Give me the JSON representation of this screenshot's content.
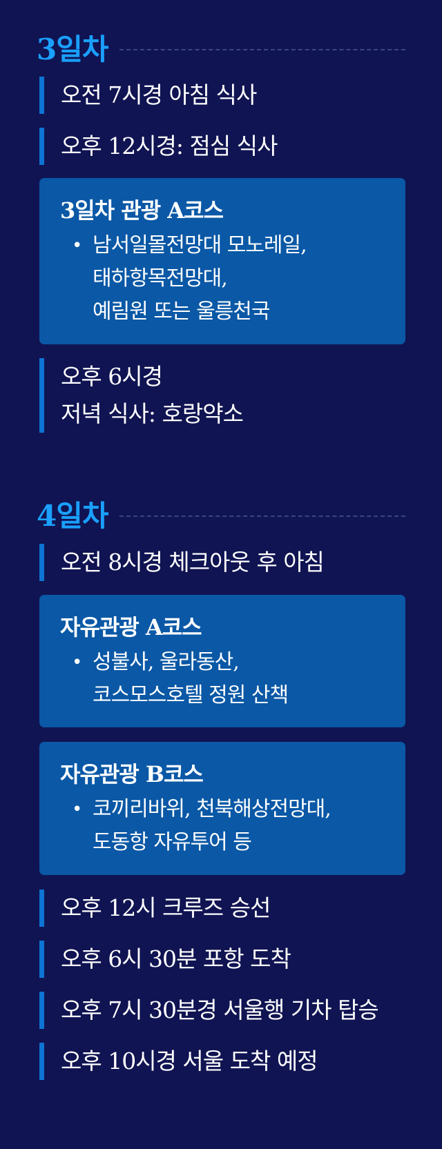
{
  "day3": {
    "title": "3일차",
    "items": [
      "오전 7시경 아침 식사",
      "오후 12시경: 점심 식사"
    ],
    "card": {
      "title": "3일차 관광 A코스",
      "lines": [
        "남서일몰전망대 모노레일,",
        "태하항목전망대,",
        "예림원 또는 울릉천국"
      ]
    },
    "evening": {
      "line1": "오후 6시경",
      "line2": "저녁 식사: 호랑약소"
    }
  },
  "day4": {
    "title": "4일차",
    "item_first": "오전 8시경 체크아웃 후 아침",
    "card_a": {
      "title": "자유관광 A코스",
      "lines": [
        "성불사, 울라동산,",
        "코스모스호텔 정원 산책"
      ]
    },
    "card_b": {
      "title": "자유관광 B코스",
      "lines": [
        "코끼리바위, 천북해상전망대,",
        "도동항 자유투어 등"
      ]
    },
    "items_after": [
      "오후 12시 크루즈 승선",
      "오후 6시 30분 포항 도착",
      "오후 7시 30분경 서울행 기차 탑승",
      "오후 10시경 서울 도착 예정"
    ]
  },
  "colors": {
    "background": "#101452",
    "accent": "#1aa0ff",
    "bar": "#0e74d4",
    "card": "#0a58a6"
  },
  "icons": {
    "bullet": "bullet-dot"
  }
}
